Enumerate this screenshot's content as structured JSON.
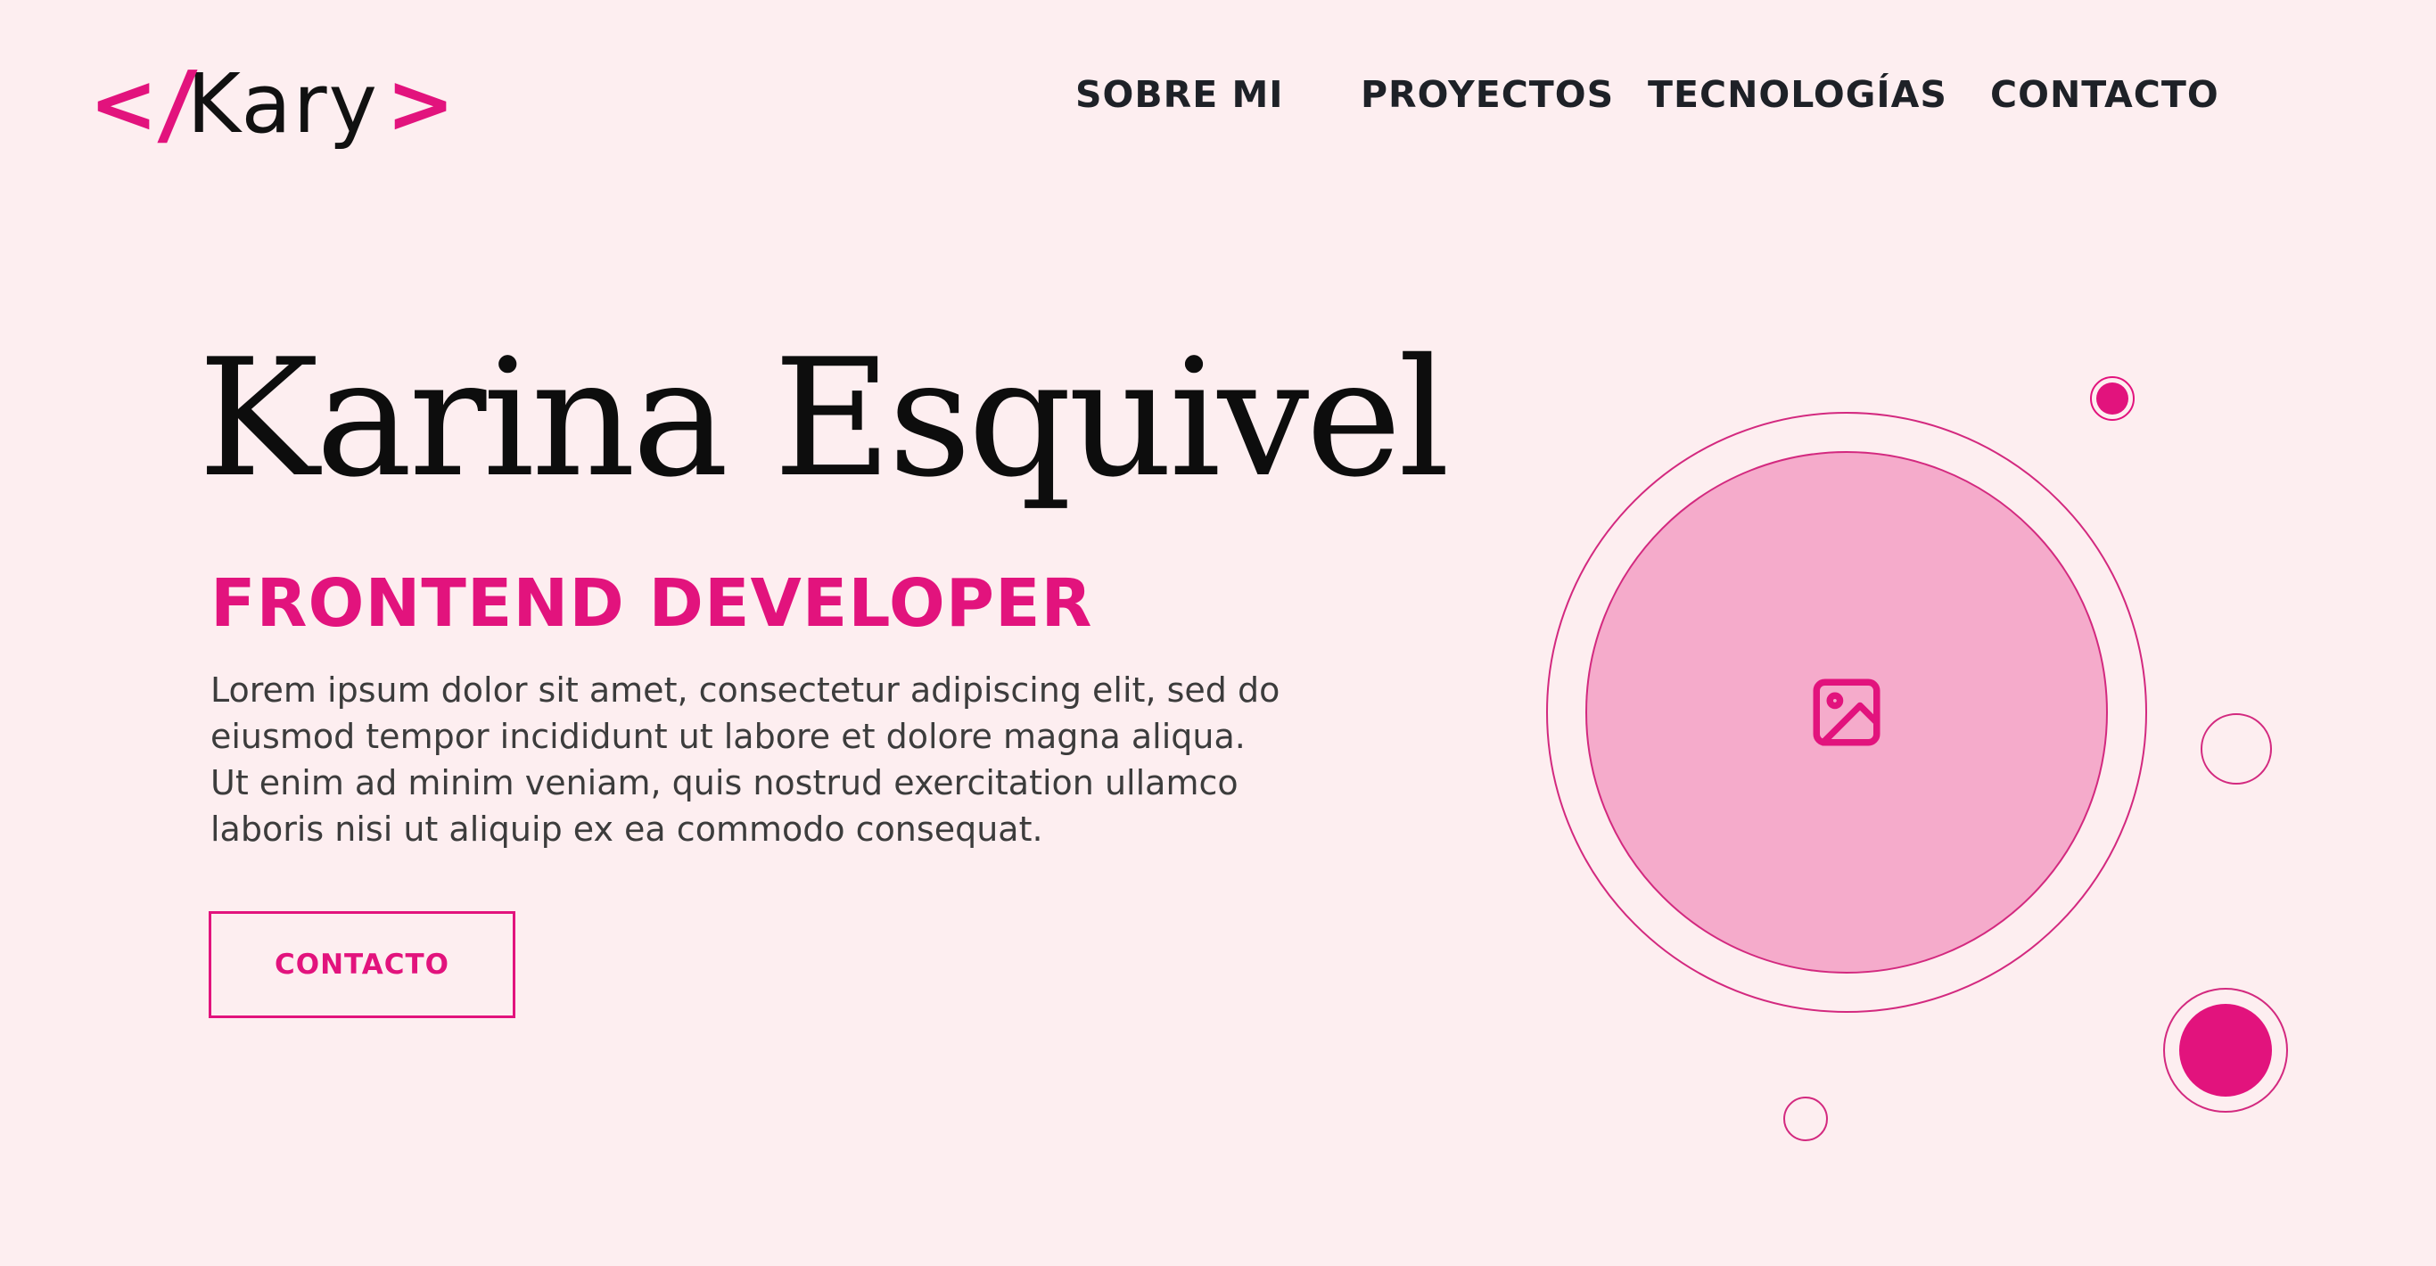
{
  "colors": {
    "background": "#fdeef0",
    "accent": "#e2137d",
    "photo_fill": "#f5abcb",
    "text_dark": "#1e2127",
    "text_body": "#3c3c3c"
  },
  "logo": {
    "open_bracket": "<",
    "slash": "/",
    "word": "Kary",
    "close_bracket": ">"
  },
  "nav": {
    "items": [
      {
        "label": "SOBRE MI"
      },
      {
        "label": "PROYECTOS"
      },
      {
        "label": "TECNOLOGÍAS"
      },
      {
        "label": "CONTACTO"
      }
    ]
  },
  "hero": {
    "name": "Karina Esquivel",
    "role": "FRONTEND DEVELOPER",
    "description_lines": [
      "Lorem ipsum dolor sit amet, consectetur adipiscing elit, sed do",
      "eiusmod tempor incididunt ut labore et dolore magna aliqua.",
      "Ut enim ad minim veniam, quis nostrud exercitation ullamco",
      "laboris nisi ut aliquip ex ea commodo consequat."
    ],
    "cta_label": "CONTACTO"
  },
  "photo": {
    "icon": "image-placeholder-icon"
  }
}
